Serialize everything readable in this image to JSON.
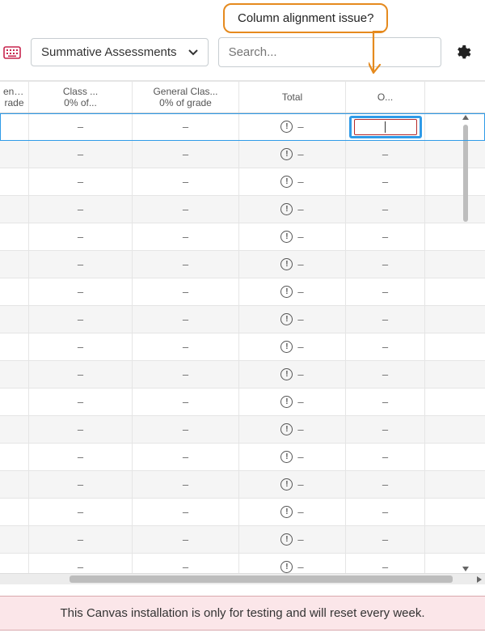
{
  "annotation": {
    "text": "Column alignment issue?"
  },
  "toolbar": {
    "dropdown_label": "Summative Assessments",
    "search_placeholder": "Search..."
  },
  "columns": [
    {
      "line1": "ent P...",
      "line2": "rade"
    },
    {
      "line1": "Class ...",
      "line2": "0% of..."
    },
    {
      "line1": "General Clas...",
      "line2": "0% of grade"
    },
    {
      "line1": "Total",
      "line2": ""
    },
    {
      "line1": "O...",
      "line2": ""
    }
  ],
  "cell_placeholder": "–",
  "total_placeholder": "–",
  "row_count": 17,
  "footer": {
    "text": "This Canvas installation is only for testing and will reset every week."
  }
}
